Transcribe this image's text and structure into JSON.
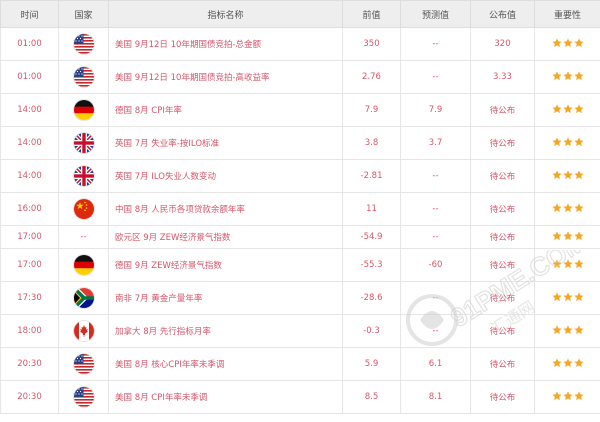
{
  "headers": [
    "时间",
    "国家",
    "指标名称",
    "前值",
    "预测值",
    "公布值",
    "重要性"
  ],
  "rows": [
    {
      "time": "01:00",
      "flag": "usa-flag-icon",
      "indicator": "美国 9月12日 10年期国债竞拍-总金额",
      "previous": "350",
      "forecast": "--",
      "actual": "320",
      "stars": 3
    },
    {
      "time": "01:00",
      "flag": "usa-flag-icon",
      "indicator": "美国 9月12日 10年期国债竞拍-高收益率",
      "previous": "2.76",
      "forecast": "--",
      "actual": "3.33",
      "stars": 3
    },
    {
      "time": "14:00",
      "flag": "germany-flag-icon",
      "indicator": "德国 8月 CPI年率",
      "previous": "7.9",
      "forecast": "7.9",
      "actual": "待公布",
      "stars": 3
    },
    {
      "time": "14:00",
      "flag": "uk-flag-icon",
      "indicator": "英国 7月 失业率-按ILO标准",
      "previous": "3.8",
      "forecast": "3.7",
      "actual": "待公布",
      "stars": 3
    },
    {
      "time": "14:00",
      "flag": "uk-flag-icon",
      "indicator": "英国 7月 ILO失业人数变动",
      "previous": "-2.81",
      "forecast": "--",
      "actual": "待公布",
      "stars": 3
    },
    {
      "time": "16:00",
      "flag": "china-flag-icon",
      "indicator": "中国 8月 人民币各项贷款余额年率",
      "previous": "11",
      "forecast": "--",
      "actual": "待公布",
      "stars": 3
    },
    {
      "time": "17:00",
      "flag": "",
      "flagText": "--",
      "indicator": "欧元区 9月 ZEW经济景气指数",
      "previous": "-54.9",
      "forecast": "--",
      "actual": "待公布",
      "stars": 3
    },
    {
      "time": "17:00",
      "flag": "germany-flag-icon",
      "indicator": "德国 9月 ZEW经济景气指数",
      "previous": "-55.3",
      "forecast": "-60",
      "actual": "待公布",
      "stars": 3
    },
    {
      "time": "17:30",
      "flag": "south-africa-flag-icon",
      "indicator": "南非 7月 黄金产量年率",
      "previous": "-28.6",
      "forecast": "--",
      "actual": "待公布",
      "stars": 3
    },
    {
      "time": "18:00",
      "flag": "canada-flag-icon",
      "indicator": "加拿大 8月 先行指标月率",
      "previous": "-0.3",
      "forecast": "--",
      "actual": "待公布",
      "stars": 3
    },
    {
      "time": "20:30",
      "flag": "usa-flag-icon",
      "indicator": "美国 8月 核心CPI年率未季调",
      "previous": "5.9",
      "forecast": "6.1",
      "actual": "待公布",
      "stars": 3
    },
    {
      "time": "20:30",
      "flag": "usa-flag-icon",
      "indicator": "美国 8月 CPI年率未季调",
      "previous": "8.5",
      "forecast": "8.1",
      "actual": "待公布",
      "stars": 3
    }
  ],
  "watermark": {
    "text": "91PME.COM",
    "subtext": "汇通网"
  },
  "colors": {
    "text": "#d8566a",
    "header_bg": "#eeeeee",
    "border": "#e6e6e6",
    "star": "#f5a623",
    "watermark": "#cfcfcf"
  }
}
